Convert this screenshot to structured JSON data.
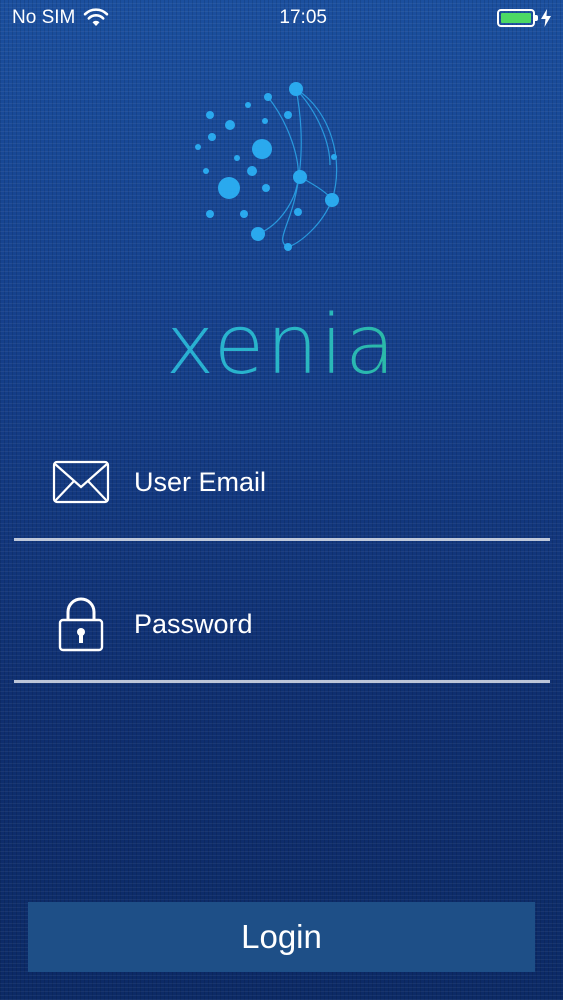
{
  "status_bar": {
    "carrier": "No SIM",
    "time": "17:05",
    "battery_color": "#4cd964",
    "icons": [
      "wifi-icon",
      "battery-icon",
      "charging-bolt-icon"
    ]
  },
  "brand": {
    "name": "xenia",
    "logo_icon": "network-sphere-icon",
    "gradient": [
      "#2aa6e6",
      "#2fbf72"
    ]
  },
  "form": {
    "email": {
      "placeholder": "User Email",
      "value": "",
      "icon": "envelope-icon"
    },
    "password": {
      "placeholder": "Password",
      "value": "",
      "icon": "padlock-icon"
    },
    "login_label": "Login"
  },
  "colors": {
    "background_top": "#1b4f9e",
    "background_bottom": "#0c2a66",
    "button": "#1e4f87"
  }
}
